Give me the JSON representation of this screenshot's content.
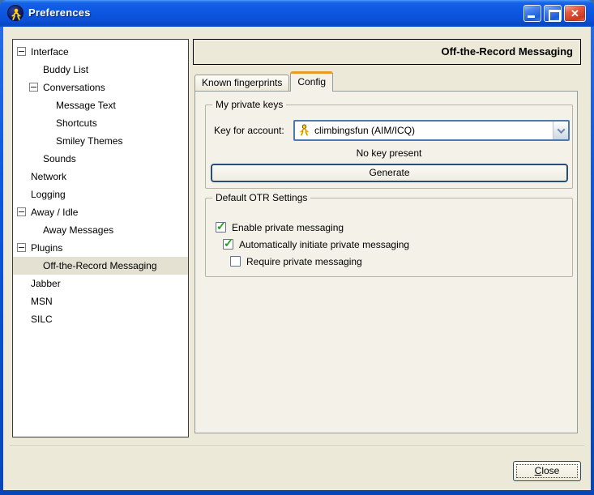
{
  "window": {
    "title": "Preferences"
  },
  "colors": {
    "titlebar_blue": "#0d57e2",
    "dialog_bg": "#ece9d8",
    "tab_page_bg": "#f3f1e8",
    "active_tab_accent": "#e89b27",
    "combo_border": "#4d79b2",
    "check_green": "#1ea01e",
    "selected_row": "#e4e1d3",
    "close_btn_red": "#e8593f"
  },
  "sidebar": {
    "items": [
      {
        "label": "Interface",
        "level": 0,
        "expander": true,
        "selected": false
      },
      {
        "label": "Buddy List",
        "level": 1,
        "expander": false,
        "selected": false
      },
      {
        "label": "Conversations",
        "level": 1,
        "expander": true,
        "selected": false
      },
      {
        "label": "Message Text",
        "level": 2,
        "expander": false,
        "selected": false
      },
      {
        "label": "Shortcuts",
        "level": 2,
        "expander": false,
        "selected": false
      },
      {
        "label": "Smiley Themes",
        "level": 2,
        "expander": false,
        "selected": false
      },
      {
        "label": "Sounds",
        "level": 1,
        "expander": false,
        "selected": false
      },
      {
        "label": "Network",
        "level": 0,
        "expander": false,
        "selected": false
      },
      {
        "label": "Logging",
        "level": 0,
        "expander": false,
        "selected": false
      },
      {
        "label": "Away / Idle",
        "level": 0,
        "expander": true,
        "selected": false
      },
      {
        "label": "Away Messages",
        "level": 1,
        "expander": false,
        "selected": false
      },
      {
        "label": "Plugins",
        "level": 0,
        "expander": true,
        "selected": false
      },
      {
        "label": "Off-the-Record Messaging",
        "level": 1,
        "expander": false,
        "selected": true
      },
      {
        "label": "Jabber",
        "level": 0,
        "expander": false,
        "selected": false
      },
      {
        "label": "MSN",
        "level": 0,
        "expander": false,
        "selected": false
      },
      {
        "label": "SILC",
        "level": 0,
        "expander": false,
        "selected": false
      }
    ]
  },
  "panel": {
    "title": "Off-the-Record Messaging",
    "tabs": [
      {
        "label": "Known fingerprints",
        "active": false
      },
      {
        "label": "Config",
        "active": true
      }
    ]
  },
  "config_tab": {
    "private_keys": {
      "legend": "My private keys",
      "account_label": "Key for account:",
      "account_value": "climbingsfun (AIM/ICQ)",
      "account_icon": "aim-buddy-icon",
      "status": "No key present",
      "generate_label": "Generate"
    },
    "otr_settings": {
      "legend": "Default OTR Settings",
      "options": [
        {
          "label": "Enable private messaging",
          "checked": true,
          "indent": 12
        },
        {
          "label": "Automatically initiate private messaging",
          "checked": true,
          "indent": 21
        },
        {
          "label": "Require private messaging",
          "checked": false,
          "indent": 30
        }
      ]
    }
  },
  "footer": {
    "close_mnemonic": "C",
    "close_rest": "lose"
  }
}
